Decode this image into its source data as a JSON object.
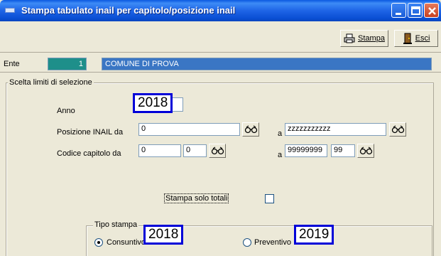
{
  "window": {
    "title": "Stampa tabulato inail per capitolo/posizione inail"
  },
  "toolbar": {
    "stampa_label": "Stampa",
    "esci_label": "Esci"
  },
  "ente": {
    "label": "Ente",
    "code": "1",
    "name": "COMUNE DI PROVA"
  },
  "selection": {
    "caption": "Scelta limiti di selezione",
    "anno_label": "Anno",
    "anno_value": "2018",
    "posizione_label": "Posizione INAIL da",
    "posizione_from": "0",
    "posizione_to_label": "a",
    "posizione_to": "zzzzzzzzzzz",
    "codice_label": "Codice capitolo da",
    "codice_from_1": "0",
    "codice_from_2": "0",
    "codice_to_label": "a",
    "codice_to_1": "99999999",
    "codice_to_2": "99",
    "solo_totali_label": "Stampa solo totali",
    "solo_totali_checked": false
  },
  "tipo_stampa": {
    "caption": "Tipo stampa",
    "consuntivo_label": "Consuntivo",
    "consuntivo_selected": true,
    "consuntivo_year": "2018",
    "preventivo_label": "Preventivo",
    "preventivo_selected": false,
    "preventivo_year": "2019"
  }
}
